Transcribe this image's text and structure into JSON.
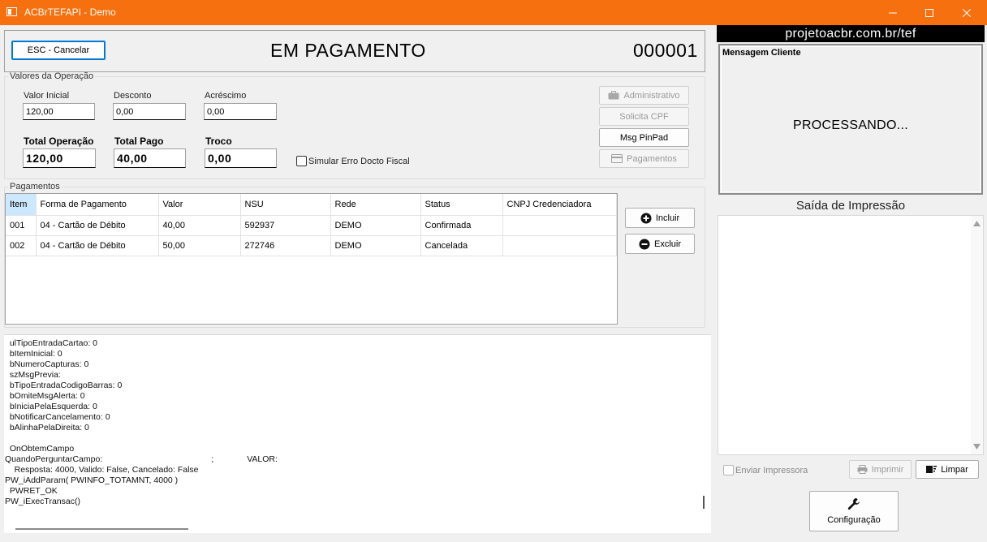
{
  "window": {
    "title": "ACBrTEFAPI - Demo",
    "minimize": "—",
    "maximize": "☐",
    "close": "✕"
  },
  "header": {
    "cancel_label": "ESC - Cancelar",
    "status_title": "EM PAGAMENTO",
    "counter": "000001"
  },
  "operation": {
    "legend": "Valores da Operação",
    "valor_inicial_label": "Valor Inicial",
    "valor_inicial": "120,00",
    "desconto_label": "Desconto",
    "desconto": "0,00",
    "acrescimo_label": "Acréscimo",
    "acrescimo": "0,00",
    "total_operacao_label": "Total Operação",
    "total_operacao": "120,00",
    "total_pago_label": "Total Pago",
    "total_pago": "40,00",
    "troco_label": "Troco",
    "troco": "0,00",
    "simular_label": "Simular Erro Docto Fiscal",
    "buttons": {
      "administrativo": "Administrativo",
      "solicita_cpf": "Solicita CPF",
      "msg_pinpad": "Msg PinPad",
      "pagamentos": "Pagamentos"
    }
  },
  "payments": {
    "legend": "Pagamentos",
    "columns": [
      "Item",
      "Forma de Pagamento",
      "Valor",
      "NSU",
      "Rede",
      "Status",
      "CNPJ Credenciadora"
    ],
    "rows": [
      [
        "001",
        "04 - Cartão de Débito",
        "40,00",
        "592937",
        "DEMO",
        "Confirmada",
        ""
      ],
      [
        "002",
        "04 - Cartão de Débito",
        "50,00",
        "272746",
        "DEMO",
        "Cancelada",
        ""
      ]
    ],
    "incluir_label": "Incluir",
    "excluir_label": "Excluir"
  },
  "log": {
    "lines": [
      "  ulTipoEntradaCartao: 0",
      "  bItemInicial: 0",
      "  bNumeroCapturas: 0",
      "  szMsgPrevia:",
      "  bTipoEntradaCodigoBarras: 0",
      "  bOmiteMsgAlerta: 0",
      "  bIniciaPelaEsquerda: 0",
      "  bNotificarCancelamento: 0",
      "  bAlinhaPelaDireita: 0",
      "",
      "  OnObtemCampo",
      "QuandoPerguntarCampo:                                              ;              VALOR:",
      "    Resposta: 4000, Valido: False, Cancelado: False",
      "PW_iAddParam( PWINFO_TOTAMNT, 4000 )",
      "  PWRET_OK",
      "PW_iExecTransac()"
    ]
  },
  "right": {
    "site": "projetoacbr.com.br/tef",
    "mensagem_label": "Mensagem Cliente",
    "processando": "PROCESSANDO...",
    "saida_label": "Saída de Impressão",
    "enviar_impressora_label": "Enviar Impressora",
    "imprimir_label": "Imprimir",
    "limpar_label": "Limpar",
    "configuracao_label": "Configuração"
  }
}
